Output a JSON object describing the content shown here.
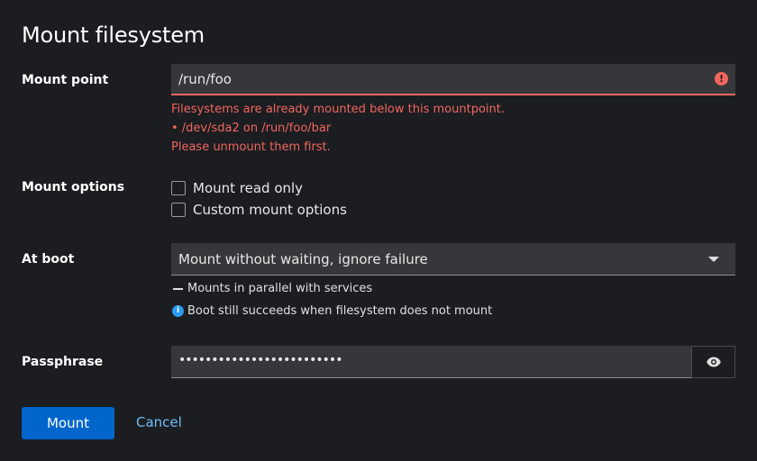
{
  "dialog": {
    "title": "Mount filesystem"
  },
  "mount_point": {
    "label": "Mount point",
    "value": "/run/foo",
    "error_icon": "exclamation-circle-icon",
    "errors": [
      "Filesystems are already mounted below this mountpoint.",
      "• /dev/sda2 on /run/foo/bar",
      "Please unmount them first."
    ]
  },
  "mount_options": {
    "label": "Mount options",
    "options": [
      {
        "label": "Mount read only",
        "checked": false
      },
      {
        "label": "Custom mount options",
        "checked": false
      }
    ]
  },
  "at_boot": {
    "label": "At boot",
    "selected": "Mount without waiting, ignore failure",
    "helpers": [
      {
        "icon": "dash-icon",
        "text": "Mounts in parallel with services"
      },
      {
        "icon": "info-icon",
        "text": "Boot still succeeds when filesystem does not mount"
      }
    ]
  },
  "passphrase": {
    "label": "Passphrase",
    "value": "•••••••••••••••••••••••••",
    "toggle_icon": "eye-icon"
  },
  "footer": {
    "mount_label": "Mount",
    "cancel_label": "Cancel"
  },
  "colors": {
    "background": "#1b1d21",
    "error": "#f0665d",
    "primary": "#0066cc",
    "link": "#73bcf7",
    "info": "#2b9af3"
  }
}
